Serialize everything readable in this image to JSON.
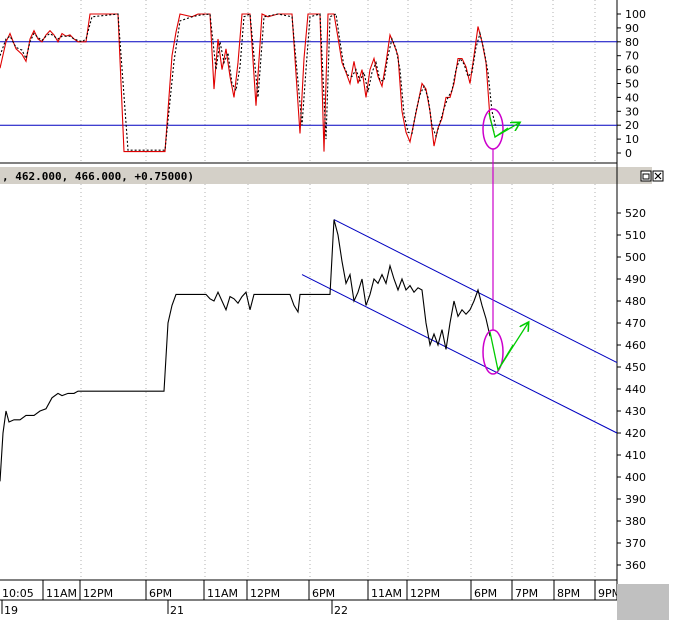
{
  "header": {
    "text": ", 462.000, 466.000, +0.75000)",
    "buttons": [
      "restore-button",
      "close-button"
    ]
  },
  "colors": {
    "price_line": "#000000",
    "oscillator_main": "#e00000",
    "oscillator_signal": "#000000",
    "levels_and_channel": "#0000c0",
    "annotation_ellipse": "#cc00cc",
    "annotation_arrow": "#00cc00",
    "grid": "#b0b0b0",
    "frame": "#000000",
    "separator": "#d0d0d0",
    "scrollbar": "#d4d0c8"
  },
  "chart_data": [
    {
      "type": "line",
      "panel": "oscillator",
      "yticks": [
        "0",
        "10",
        "20",
        "30",
        "40",
        "50",
        "60",
        "70",
        "80",
        "90",
        "100"
      ],
      "ylim": [
        -8,
        105
      ],
      "hlines": [
        80,
        20
      ],
      "grid": "vertical dotted",
      "series": [
        {
          "values": [
            [
              0,
              61
            ],
            [
              6,
              80
            ],
            [
              10,
              86
            ],
            [
              16,
              75
            ],
            [
              22,
              71
            ],
            [
              26,
              66
            ],
            [
              30,
              82
            ],
            [
              34,
              88
            ],
            [
              38,
              82
            ],
            [
              42,
              80
            ],
            [
              46,
              85
            ],
            [
              50,
              88
            ],
            [
              54,
              85
            ],
            [
              58,
              80
            ],
            [
              62,
              86
            ],
            [
              66,
              84
            ],
            [
              70,
              85
            ],
            [
              74,
              82
            ],
            [
              78,
              80
            ],
            [
              82,
              80
            ],
            [
              86,
              80
            ],
            [
              90,
              100
            ],
            [
              118,
              100
            ],
            [
              124,
              1
            ],
            [
              165,
              1
            ],
            [
              172,
              70
            ],
            [
              176,
              87
            ],
            [
              180,
              100
            ],
            [
              192,
              98
            ],
            [
              198,
              100
            ],
            [
              210,
              100
            ],
            [
              214,
              46
            ],
            [
              218,
              82
            ],
            [
              222,
              60
            ],
            [
              226,
              75
            ],
            [
              230,
              55
            ],
            [
              234,
              40
            ],
            [
              238,
              65
            ],
            [
              242,
              100
            ],
            [
              250,
              100
            ],
            [
              256,
              34
            ],
            [
              262,
              100
            ],
            [
              268,
              98
            ],
            [
              278,
              100
            ],
            [
              292,
              100
            ],
            [
              300,
              14
            ],
            [
              304,
              68
            ],
            [
              308,
              100
            ],
            [
              320,
              100
            ],
            [
              324,
              1
            ],
            [
              328,
              100
            ],
            [
              334,
              100
            ],
            [
              338,
              83
            ],
            [
              342,
              65
            ],
            [
              346,
              58
            ],
            [
              350,
              50
            ],
            [
              354,
              66
            ],
            [
              358,
              50
            ],
            [
              362,
              60
            ],
            [
              366,
              40
            ],
            [
              370,
              60
            ],
            [
              374,
              68
            ],
            [
              378,
              55
            ],
            [
              382,
              48
            ],
            [
              386,
              65
            ],
            [
              390,
              85
            ],
            [
              394,
              78
            ],
            [
              398,
              70
            ],
            [
              402,
              30
            ],
            [
              406,
              15
            ],
            [
              410,
              8
            ],
            [
              414,
              22
            ],
            [
              418,
              36
            ],
            [
              422,
              50
            ],
            [
              426,
              46
            ],
            [
              430,
              30
            ],
            [
              434,
              5
            ],
            [
              438,
              18
            ],
            [
              442,
              25
            ],
            [
              446,
              40
            ],
            [
              450,
              40
            ],
            [
              454,
              50
            ],
            [
              458,
              68
            ],
            [
              462,
              68
            ],
            [
              466,
              62
            ],
            [
              470,
              50
            ],
            [
              474,
              70
            ],
            [
              478,
              91
            ],
            [
              482,
              80
            ],
            [
              486,
              65
            ],
            [
              490,
              25
            ],
            [
              494,
              15
            ]
          ]
        },
        {
          "values": [
            [
              0,
              70
            ],
            [
              6,
              82
            ],
            [
              10,
              84
            ],
            [
              16,
              76
            ],
            [
              22,
              74
            ],
            [
              26,
              68
            ],
            [
              30,
              80
            ],
            [
              34,
              86
            ],
            [
              38,
              83
            ],
            [
              42,
              81
            ],
            [
              46,
              84
            ],
            [
              50,
              86
            ],
            [
              54,
              84
            ],
            [
              58,
              82
            ],
            [
              62,
              84
            ],
            [
              66,
              84
            ],
            [
              70,
              84
            ],
            [
              74,
              82
            ],
            [
              78,
              81
            ],
            [
              82,
              80
            ],
            [
              86,
              82
            ],
            [
              92,
              98
            ],
            [
              118,
              100
            ],
            [
              128,
              2
            ],
            [
              165,
              2
            ],
            [
              174,
              66
            ],
            [
              180,
              95
            ],
            [
              192,
              98
            ],
            [
              198,
              99
            ],
            [
              210,
              100
            ],
            [
              216,
              60
            ],
            [
              220,
              80
            ],
            [
              224,
              65
            ],
            [
              228,
              72
            ],
            [
              232,
              50
            ],
            [
              236,
              45
            ],
            [
              240,
              62
            ],
            [
              244,
              98
            ],
            [
              250,
              100
            ],
            [
              258,
              40
            ],
            [
              264,
              98
            ],
            [
              278,
              100
            ],
            [
              292,
              98
            ],
            [
              302,
              20
            ],
            [
              306,
              60
            ],
            [
              310,
              98
            ],
            [
              320,
              100
            ],
            [
              326,
              10
            ],
            [
              330,
              98
            ],
            [
              336,
              100
            ],
            [
              340,
              80
            ],
            [
              344,
              62
            ],
            [
              348,
              56
            ],
            [
              352,
              55
            ],
            [
              356,
              60
            ],
            [
              360,
              52
            ],
            [
              364,
              58
            ],
            [
              368,
              44
            ],
            [
              372,
              58
            ],
            [
              376,
              65
            ],
            [
              380,
              52
            ],
            [
              384,
              52
            ],
            [
              388,
              70
            ],
            [
              392,
              82
            ],
            [
              396,
              75
            ],
            [
              400,
              60
            ],
            [
              404,
              28
            ],
            [
              408,
              15
            ],
            [
              412,
              14
            ],
            [
              416,
              30
            ],
            [
              420,
              42
            ],
            [
              424,
              48
            ],
            [
              428,
              40
            ],
            [
              432,
              20
            ],
            [
              436,
              12
            ],
            [
              440,
              22
            ],
            [
              444,
              32
            ],
            [
              448,
              40
            ],
            [
              452,
              45
            ],
            [
              456,
              60
            ],
            [
              460,
              68
            ],
            [
              464,
              64
            ],
            [
              468,
              55
            ],
            [
              472,
              58
            ],
            [
              476,
              76
            ],
            [
              480,
              86
            ],
            [
              484,
              74
            ],
            [
              488,
              58
            ],
            [
              492,
              30
            ],
            [
              496,
              18
            ]
          ]
        }
      ]
    },
    {
      "type": "line",
      "panel": "price",
      "xticks": [
        "10:05",
        "11AM",
        "12PM",
        "6PM",
        "11AM",
        "12PM",
        "6PM",
        "11AM",
        "12PM",
        "6PM",
        "7PM",
        "8PM",
        "9PM"
      ],
      "date_labels": [
        "19",
        "21",
        "22"
      ],
      "yticks": [
        "360",
        "370",
        "380",
        "390",
        "400",
        "410",
        "420",
        "430",
        "440",
        "450",
        "460",
        "470",
        "480",
        "490",
        "500",
        "510",
        "520"
      ],
      "ylim": [
        350,
        528
      ],
      "grid": "vertical dotted",
      "series": [
        {
          "values": [
            [
              0,
              398
            ],
            [
              3,
              420
            ],
            [
              6,
              430
            ],
            [
              9,
              425
            ],
            [
              14,
              426
            ],
            [
              20,
              426
            ],
            [
              26,
              428
            ],
            [
              34,
              428
            ],
            [
              40,
              430
            ],
            [
              46,
              431
            ],
            [
              52,
              436
            ],
            [
              58,
              438
            ],
            [
              62,
              437
            ],
            [
              68,
              438
            ],
            [
              74,
              438
            ],
            [
              78,
              439
            ],
            [
              85,
              439
            ],
            [
              164,
              439
            ],
            [
              168,
              470
            ],
            [
              172,
              478
            ],
            [
              176,
              483
            ],
            [
              186,
              483
            ],
            [
              206,
              483
            ],
            [
              210,
              481
            ],
            [
              214,
              480
            ],
            [
              218,
              484
            ],
            [
              222,
              480
            ],
            [
              226,
              476
            ],
            [
              230,
              482
            ],
            [
              234,
              481
            ],
            [
              238,
              479
            ],
            [
              242,
              482
            ],
            [
              246,
              484
            ],
            [
              250,
              476
            ],
            [
              254,
              483
            ],
            [
              258,
              483
            ],
            [
              290,
              483
            ],
            [
              294,
              478
            ],
            [
              298,
              475
            ],
            [
              300,
              483
            ],
            [
              330,
              483
            ],
            [
              334,
              517
            ],
            [
              338,
              510
            ],
            [
              342,
              498
            ],
            [
              346,
              488
            ],
            [
              350,
              492
            ],
            [
              354,
              480
            ],
            [
              358,
              484
            ],
            [
              362,
              490
            ],
            [
              366,
              478
            ],
            [
              370,
              483
            ],
            [
              374,
              490
            ],
            [
              378,
              488
            ],
            [
              382,
              492
            ],
            [
              386,
              488
            ],
            [
              390,
              496
            ],
            [
              394,
              490
            ],
            [
              398,
              485
            ],
            [
              402,
              490
            ],
            [
              406,
              485
            ],
            [
              410,
              487
            ],
            [
              414,
              484
            ],
            [
              418,
              486
            ],
            [
              422,
              485
            ],
            [
              426,
              470
            ],
            [
              430,
              460
            ],
            [
              434,
              465
            ],
            [
              438,
              460
            ],
            [
              442,
              467
            ],
            [
              446,
              458
            ],
            [
              450,
              470
            ],
            [
              454,
              480
            ],
            [
              458,
              473
            ],
            [
              462,
              476
            ],
            [
              466,
              474
            ],
            [
              470,
              476
            ],
            [
              474,
              480
            ],
            [
              478,
              485
            ],
            [
              482,
              478
            ],
            [
              486,
              472
            ],
            [
              490,
              464
            ]
          ]
        }
      ],
      "channel": {
        "upper": [
          [
            334,
            517
          ],
          [
            617,
            452
          ]
        ],
        "lower": [
          [
            302,
            492
          ],
          [
            617,
            420
          ]
        ]
      }
    }
  ]
}
